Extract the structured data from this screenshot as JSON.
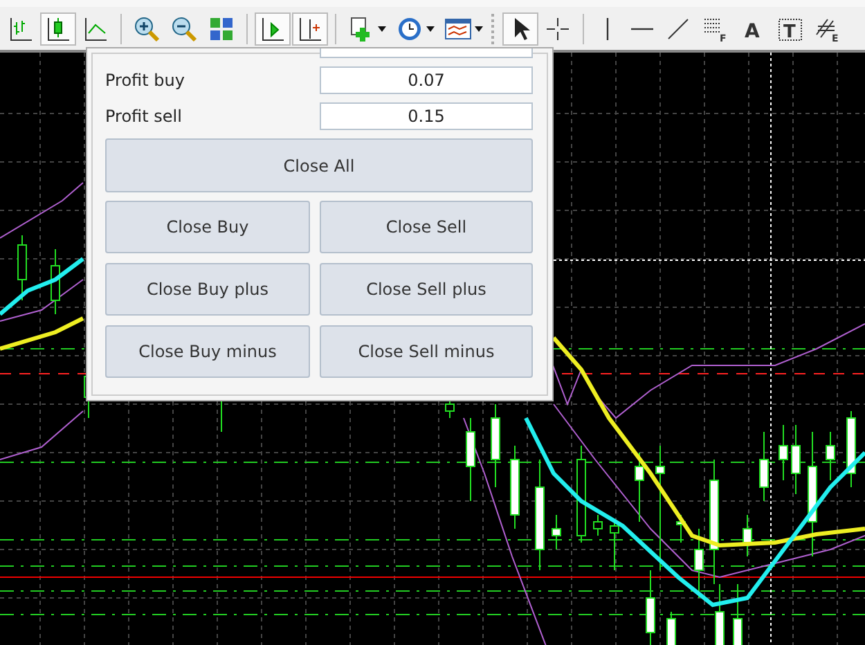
{
  "toolbar": [
    {
      "kind": "bar-chart",
      "selected": false
    },
    {
      "kind": "candle-chart",
      "selected": true
    },
    {
      "kind": "line-chart",
      "selected": false
    },
    {
      "kind": "separator"
    },
    {
      "kind": "zoom-in",
      "selected": false
    },
    {
      "kind": "zoom-out",
      "selected": false
    },
    {
      "kind": "tile",
      "selected": false
    },
    {
      "kind": "separator"
    },
    {
      "kind": "autoscroll",
      "selected": true
    },
    {
      "kind": "chart-shift",
      "selected": true
    },
    {
      "kind": "separator"
    },
    {
      "kind": "new-order",
      "selected": false,
      "dropdown": true
    },
    {
      "kind": "clock",
      "selected": false,
      "dropdown": true
    },
    {
      "kind": "template",
      "selected": false,
      "dropdown": true
    },
    {
      "kind": "grip"
    },
    {
      "kind": "cursor",
      "selected": true
    },
    {
      "kind": "crosshair",
      "selected": false
    },
    {
      "kind": "separator"
    },
    {
      "kind": "vline",
      "selected": false
    },
    {
      "kind": "hline",
      "selected": false
    },
    {
      "kind": "trendline",
      "selected": false
    },
    {
      "kind": "fibo",
      "selected": false,
      "sub": "F"
    },
    {
      "kind": "text",
      "selected": false,
      "letter": "A"
    },
    {
      "kind": "label",
      "selected": false,
      "letter": "T"
    },
    {
      "kind": "elliott",
      "selected": false,
      "sub": "E"
    }
  ],
  "panel": {
    "fields": [
      {
        "label": "Profit buy",
        "value": "0.07"
      },
      {
        "label": "Profit sell",
        "value": "0.15"
      }
    ],
    "buttons": [
      {
        "label": "Close All",
        "kind": "wide"
      },
      {
        "label": "Close Buy",
        "kind": "half"
      },
      {
        "label": "Close Sell",
        "kind": "half"
      },
      {
        "label": "Close Buy plus",
        "kind": "half"
      },
      {
        "label": "Close Sell plus",
        "kind": "half"
      },
      {
        "label": "Close Buy minus",
        "kind": "half"
      },
      {
        "label": "Close Sell minus",
        "kind": "half"
      }
    ]
  }
}
